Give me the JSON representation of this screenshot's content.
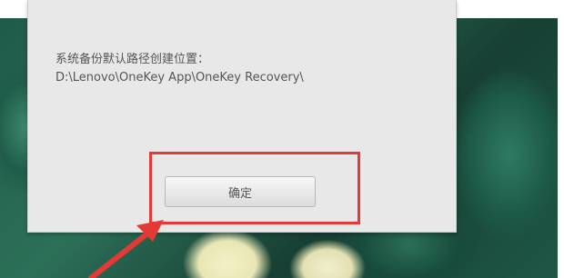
{
  "dialog": {
    "message_line1": "系统备份默认路径创建位置：",
    "message_line2": "D:\\Lenovo\\OneKey App\\OneKey Recovery\\",
    "ok_label": "确定"
  },
  "annotation": {
    "color": "#e53935"
  }
}
